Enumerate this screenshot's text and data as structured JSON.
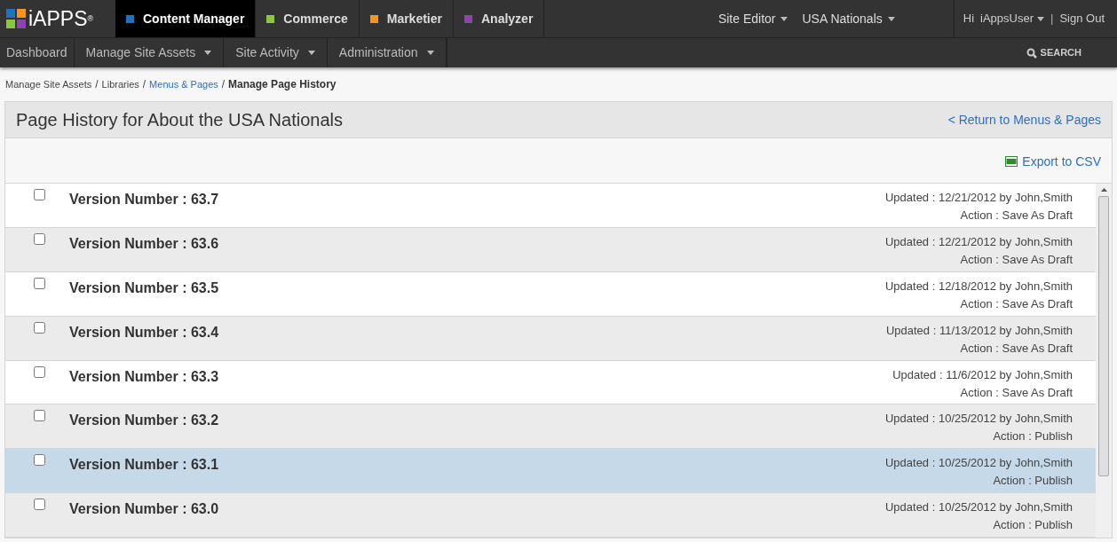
{
  "logo": {
    "text": "iAPPS",
    "mark": "®"
  },
  "products": [
    {
      "label": "Content Manager",
      "color": "#1e73be",
      "selected": true
    },
    {
      "label": "Commerce",
      "color": "#8cc63f",
      "selected": false
    },
    {
      "label": "Marketier",
      "color": "#f7941d",
      "selected": false
    },
    {
      "label": "Analyzer",
      "color": "#8e44ad",
      "selected": false
    }
  ],
  "site_menus": [
    "Site Editor",
    "USA Nationals"
  ],
  "user": {
    "greeting": "Hi",
    "name": "iAppsUser",
    "separator": "|",
    "sign_out": "Sign Out"
  },
  "breadcrumb_separator": "/",
  "nav": [
    {
      "label": "Dashboard",
      "dropdown": false
    },
    {
      "label": "Manage Site Assets",
      "dropdown": true
    },
    {
      "label": "Site Activity",
      "dropdown": true
    },
    {
      "label": "Administration",
      "dropdown": true
    }
  ],
  "search": "SEARCH",
  "breadcrumb": [
    {
      "label": "Manage Site Assets",
      "kind": "plain"
    },
    {
      "label": "Libraries",
      "kind": "plain"
    },
    {
      "label": "Menus & Pages",
      "kind": "link"
    },
    {
      "label": "Manage Page History",
      "kind": "current"
    }
  ],
  "panel": {
    "title": "Page History for About the USA Nationals",
    "return_link": "< Return to Menus & Pages",
    "export": "Export to CSV"
  },
  "versions": [
    {
      "title": "Version Number : 63.7",
      "updated": "Updated : 12/21/2012 by John,Smith",
      "action": "Action : Save As Draft",
      "checked": false,
      "selected": false
    },
    {
      "title": "Version Number : 63.6",
      "updated": "Updated : 12/21/2012 by John,Smith",
      "action": "Action : Save As Draft",
      "checked": false,
      "selected": false
    },
    {
      "title": "Version Number : 63.5",
      "updated": "Updated : 12/18/2012 by John,Smith",
      "action": "Action : Save As Draft",
      "checked": false,
      "selected": false
    },
    {
      "title": "Version Number : 63.4",
      "updated": "Updated : 11/13/2012 by John,Smith",
      "action": "Action : Save As Draft",
      "checked": false,
      "selected": false
    },
    {
      "title": "Version Number : 63.3",
      "updated": "Updated : 11/6/2012 by John,Smith",
      "action": "Action : Save As Draft",
      "checked": false,
      "selected": false
    },
    {
      "title": "Version Number : 63.2",
      "updated": "Updated : 10/25/2012 by John,Smith",
      "action": "Action : Publish",
      "checked": false,
      "selected": false
    },
    {
      "title": "Version Number : 63.1",
      "updated": "Updated : 10/25/2012 by John,Smith",
      "action": "Action : Publish",
      "checked": false,
      "selected": true
    },
    {
      "title": "Version Number : 63.0",
      "updated": "Updated : 10/25/2012 by John,Smith",
      "action": "Action : Publish",
      "checked": false,
      "selected": false
    }
  ]
}
